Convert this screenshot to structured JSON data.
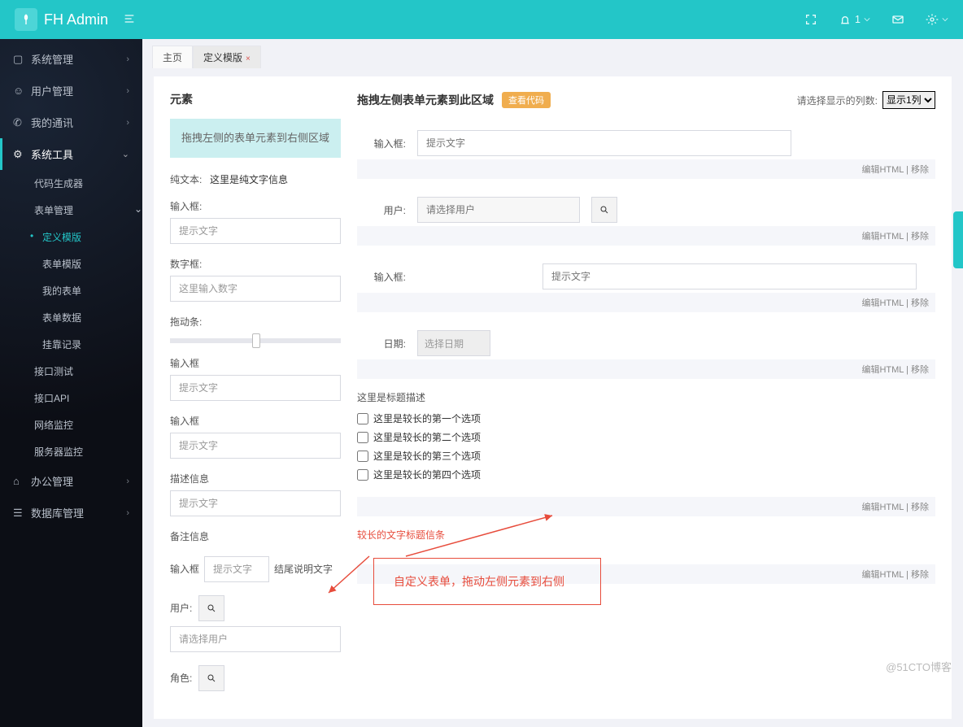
{
  "brand": "FH Admin",
  "topbar": {
    "notif_count": "1"
  },
  "sidebar": [
    {
      "label": "系统管理",
      "expand": "right"
    },
    {
      "label": "用户管理",
      "expand": "right"
    },
    {
      "label": "我的通讯",
      "expand": "right"
    },
    {
      "label": "系统工具",
      "expand": "down",
      "active": true,
      "children": [
        {
          "label": "代码生成器"
        },
        {
          "label": "表单管理",
          "expand": "down",
          "children": [
            {
              "label": "定义模版",
              "selected": true
            },
            {
              "label": "表单模版"
            },
            {
              "label": "我的表单"
            },
            {
              "label": "表单数据"
            },
            {
              "label": "挂靠记录"
            }
          ]
        },
        {
          "label": "接口测试"
        },
        {
          "label": "接口API"
        },
        {
          "label": "网络监控"
        },
        {
          "label": "服务器监控"
        }
      ]
    },
    {
      "label": "办公管理",
      "expand": "right"
    },
    {
      "label": "数据库管理",
      "expand": "right"
    }
  ],
  "tabs": [
    {
      "label": "主页",
      "closable": false
    },
    {
      "label": "定义模版",
      "closable": true,
      "active": true
    }
  ],
  "left": {
    "heading": "元素",
    "hint": "拖拽左侧的表单元素到右侧区域",
    "plaintext_label": "纯文本:",
    "plaintext_value": "这里是纯文字信息",
    "input1_label": "输入框:",
    "input1_ph": "提示文字",
    "num_label": "数字框:",
    "num_ph": "这里输入数字",
    "slider_label": "拖动条:",
    "input2_label": "输入框",
    "input2_ph": "提示文字",
    "input3_label": "输入框",
    "input3_ph": "提示文字",
    "desc_label": "描述信息",
    "desc_ph": "提示文字",
    "note_label": "备注信息",
    "inline_input_label": "输入框",
    "inline_input_ph": "提示文字",
    "inline_input_tail": "结尾说明文字",
    "user_label": "用户:",
    "user_ph": "请选择用户",
    "role_label": "角色:"
  },
  "mid": {
    "heading": "拖拽左侧表单元素到此区域",
    "viewcode": "查看代码",
    "col_hint": "请选择显示的列数:",
    "col_value": "显示1列",
    "edit": "编辑HTML",
    "remove": "移除",
    "r1_label": "输入框:",
    "r1_ph": "提示文字",
    "r2_label": "用户:",
    "r2_ph": "请选择用户",
    "r3_label": "输入框:",
    "r3_ph": "提示文字",
    "r4_label": "日期:",
    "r4_ph": "选择日期",
    "chk_title": "这里是标题描述",
    "chk_opts": [
      "这里是较长的第一个选项",
      "这里是较长的第二个选项",
      "这里是较长的第三个选项",
      "这里是较长的第四个选项"
    ],
    "long_title": "较长的文字标题信条"
  },
  "annotation": "自定义表单，拖动左侧元素到右侧",
  "watermark": "@51CTO博客"
}
